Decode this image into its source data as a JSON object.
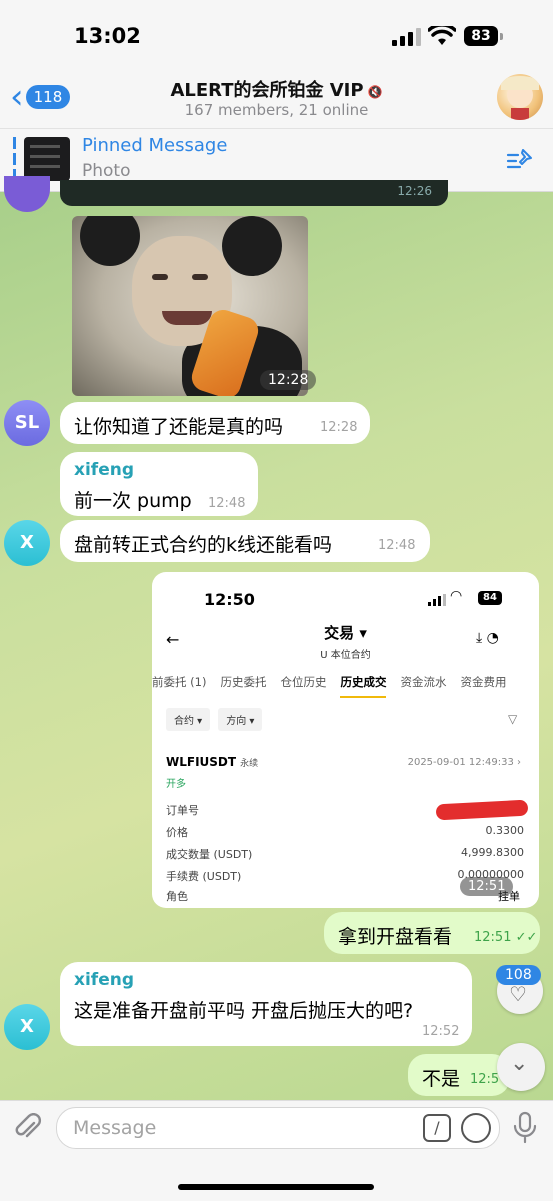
{
  "status": {
    "time": "13:02",
    "battery": "83"
  },
  "header": {
    "back_count": "118",
    "title": "ALERT的会所铂金 VIP",
    "subtitle": "167 members, 21 online"
  },
  "pinned": {
    "title": "Pinned Message",
    "subtitle": "Photo"
  },
  "messages": {
    "top_time": "12:26",
    "sticker_time": "12:28",
    "m1": {
      "avatar": "SL",
      "text": "让你知道了还能是真的吗",
      "time": "12:28"
    },
    "m2": {
      "sender": "xifeng",
      "text": "前一次 pump",
      "time": "12:48"
    },
    "m3": {
      "avatar": "X",
      "text": "盘前转正式合约的k线还能看吗",
      "time": "12:48"
    },
    "m4": {
      "time": "12:51",
      "action": "挂单"
    },
    "m5": {
      "text": "拿到开盘看看",
      "time": "12:51"
    },
    "m6": {
      "sender": "xifeng",
      "avatar": "X",
      "text": "这是准备开盘前平吗 开盘后抛压大的吧?",
      "time": "12:52"
    },
    "m7": {
      "text": "不是",
      "time": "12:5"
    }
  },
  "screenshot": {
    "time": "12:50",
    "battery": "84",
    "title": "交易",
    "subtitle": "U 本位合约",
    "tabs": [
      "前委托 (1)",
      "历史委托",
      "仓位历史",
      "历史成交",
      "资金流水",
      "资金费用"
    ],
    "active_tab": "历史成交",
    "filters": [
      "合约",
      "方向"
    ],
    "pair": "WLFIUSDT",
    "perp": "永续",
    "date": "2025-09-01 12:49:33",
    "side": "开多",
    "rows": [
      {
        "label": "订单号",
        "value": ""
      },
      {
        "label": "价格",
        "value": "0.3300"
      },
      {
        "label": "成交数量 (USDT)",
        "value": "4,999.8300"
      },
      {
        "label": "手续费 (USDT)",
        "value": "0.00000000"
      },
      {
        "label": "角色",
        "value": ""
      }
    ]
  },
  "reaction_count": "108",
  "input": {
    "placeholder": "Message"
  },
  "colors": {
    "accent": "#2f86e4",
    "outgoing": "#e2fbc9",
    "sender": "#27a1b5"
  }
}
